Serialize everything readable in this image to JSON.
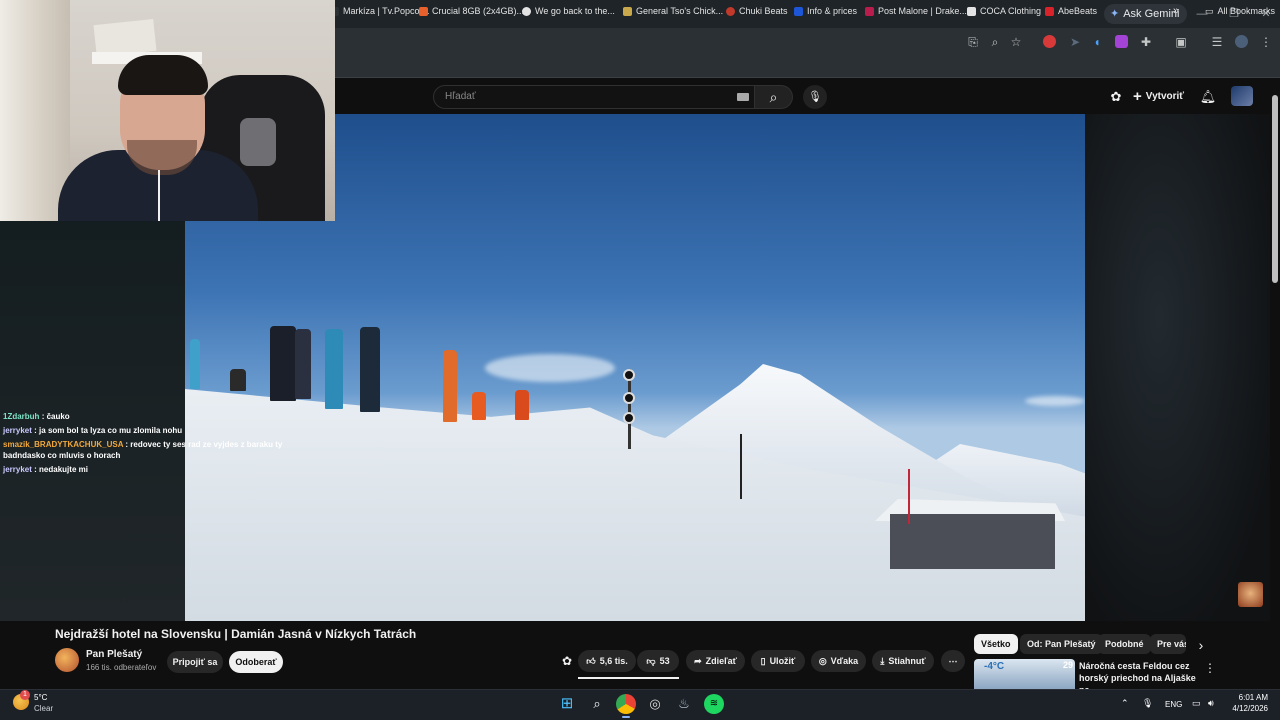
{
  "browser": {
    "ask_gemini": "Ask Gemini",
    "bookmarks": [
      {
        "label": "Markíza | Tv.Popcor...",
        "color": "#2b3035"
      },
      {
        "label": "Crucial 8GB (2x4GB)...",
        "color": "#e8602c"
      },
      {
        "label": "We go back to the...",
        "color": "#e3e3e3"
      },
      {
        "label": "General Tso's Chick...",
        "color": "#c9a84c"
      },
      {
        "label": "Chuki Beats",
        "color": "#c0392b"
      },
      {
        "label": "Info & prices",
        "color": "#1e56d8"
      },
      {
        "label": "Post Malone | Drake...",
        "color": "#b81d4e"
      },
      {
        "label": "COCA Clothing",
        "color": "#e3e3e3"
      },
      {
        "label": "AbeBeats",
        "color": "#d8232a"
      }
    ],
    "bookmarks_more": "»",
    "all_bookmarks": "All Bookmarks"
  },
  "youtube": {
    "search_placeholder": "Hľadať",
    "create_label": "Vytvoriť",
    "video_title": "Nejdražší hotel na Slovensku | Damián Jasná v Nízkych Tatrách",
    "channel_name": "Pan Plešatý",
    "subscribers": "166 tis. odberateľov",
    "join_label": "Pripojiť sa",
    "subscribe_label": "Odoberať",
    "likes": "5,6 tis.",
    "dislikes": "53",
    "share_label": "Zdieľať",
    "save_label": "Uložiť",
    "thanks_label": "Vďaka",
    "download_label": "Stiahnuť",
    "chips": [
      "Všetko",
      "Od: Pan Plešatý",
      "Podobné",
      "Pre vás"
    ],
    "rec_title": "Náročná cesta Feldou cez horský priechod na Aljaške na ...",
    "rec_badge": "29"
  },
  "chat": [
    {
      "user": "1Zdarbuh",
      "color": "#7fe3c8",
      "text": ": čauko"
    },
    {
      "user": "jerryket",
      "color": "#c9c9ff",
      "text": ": ja som bol ta lyza co mu zlomila nohu"
    },
    {
      "user": "smazik_BRADYTKACHUK_USA",
      "color": "#f2a93b",
      "text": ": redovec ty ses rad ze vyjdes z baraku ty badndasko co mluvis o horach"
    },
    {
      "user": "jerryket",
      "color": "#c9c9ff",
      "text": ": nedakujte mi"
    }
  ],
  "taskbar": {
    "temp": "5°C",
    "weather": "Clear",
    "weather_badge": "1",
    "lang": "ENG",
    "time": "6:01 AM",
    "date": "4/12/2026"
  }
}
